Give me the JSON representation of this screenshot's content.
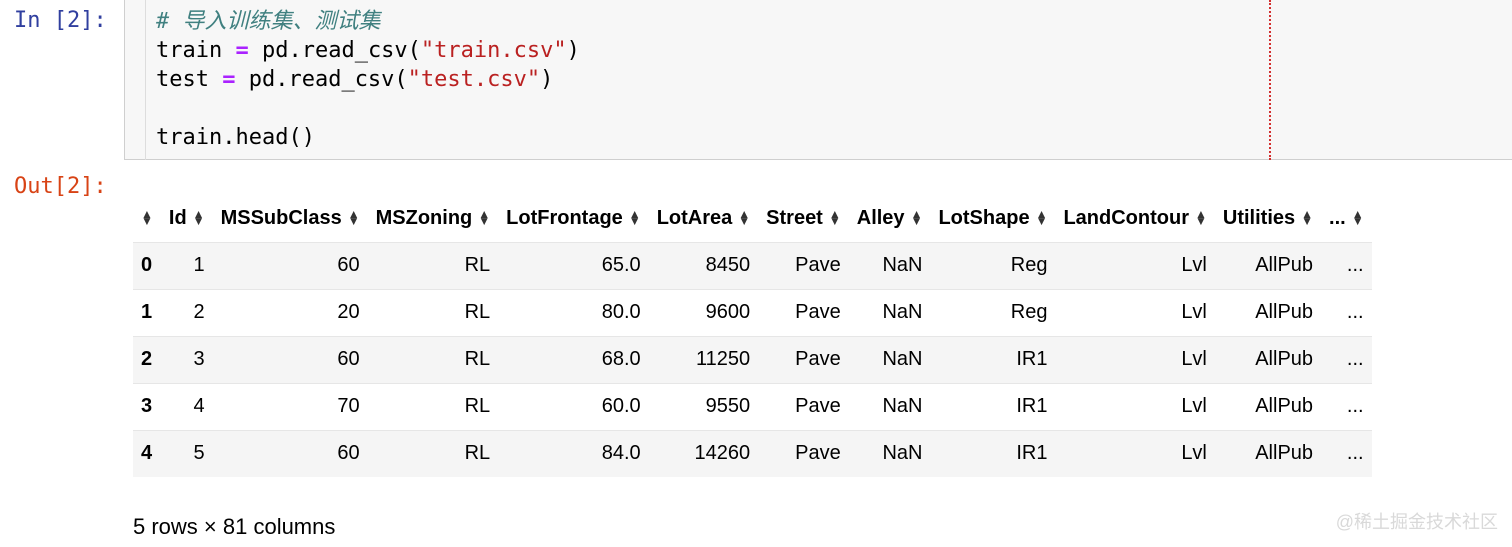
{
  "cell": {
    "in_prompt": "In [2]:",
    "out_prompt": "Out[2]:",
    "code": {
      "comment": "# 导入训练集、测试集",
      "line_train_a": "train ",
      "line_train_op": "=",
      "line_train_b": " pd.read_csv(",
      "line_train_str": "\"train.csv\"",
      "line_train_c": ")",
      "line_test_a": "test ",
      "line_test_op": "=",
      "line_test_b": " pd.read_csv(",
      "line_test_str": "\"test.csv\"",
      "line_test_c": ")",
      "line_head": "train.head()"
    }
  },
  "table": {
    "columns": [
      "Id",
      "MSSubClass",
      "MSZoning",
      "LotFrontage",
      "LotArea",
      "Street",
      "Alley",
      "LotShape",
      "LandContour",
      "Utilities",
      "..."
    ],
    "rows": [
      {
        "index": "0",
        "cells": [
          "1",
          "60",
          "RL",
          "65.0",
          "8450",
          "Pave",
          "NaN",
          "Reg",
          "Lvl",
          "AllPub",
          "..."
        ]
      },
      {
        "index": "1",
        "cells": [
          "2",
          "20",
          "RL",
          "80.0",
          "9600",
          "Pave",
          "NaN",
          "Reg",
          "Lvl",
          "AllPub",
          "..."
        ]
      },
      {
        "index": "2",
        "cells": [
          "3",
          "60",
          "RL",
          "68.0",
          "11250",
          "Pave",
          "NaN",
          "IR1",
          "Lvl",
          "AllPub",
          "..."
        ]
      },
      {
        "index": "3",
        "cells": [
          "4",
          "70",
          "RL",
          "60.0",
          "9550",
          "Pave",
          "NaN",
          "IR1",
          "Lvl",
          "AllPub",
          "..."
        ]
      },
      {
        "index": "4",
        "cells": [
          "5",
          "60",
          "RL",
          "84.0",
          "14260",
          "Pave",
          "NaN",
          "IR1",
          "Lvl",
          "AllPub",
          "..."
        ]
      }
    ],
    "shape_info": "5 rows × 81 columns"
  },
  "watermark": "@稀土掘金技术社区",
  "icons": {
    "collapser": "triangle-down-icon",
    "sort": "sort-updown-icon"
  },
  "colors": {
    "in_prompt": "#303f9f",
    "out_prompt": "#d84315",
    "comment": "#408080",
    "operator": "#aa22ff",
    "string": "#ba2121",
    "ruler": "#d32f2f"
  }
}
